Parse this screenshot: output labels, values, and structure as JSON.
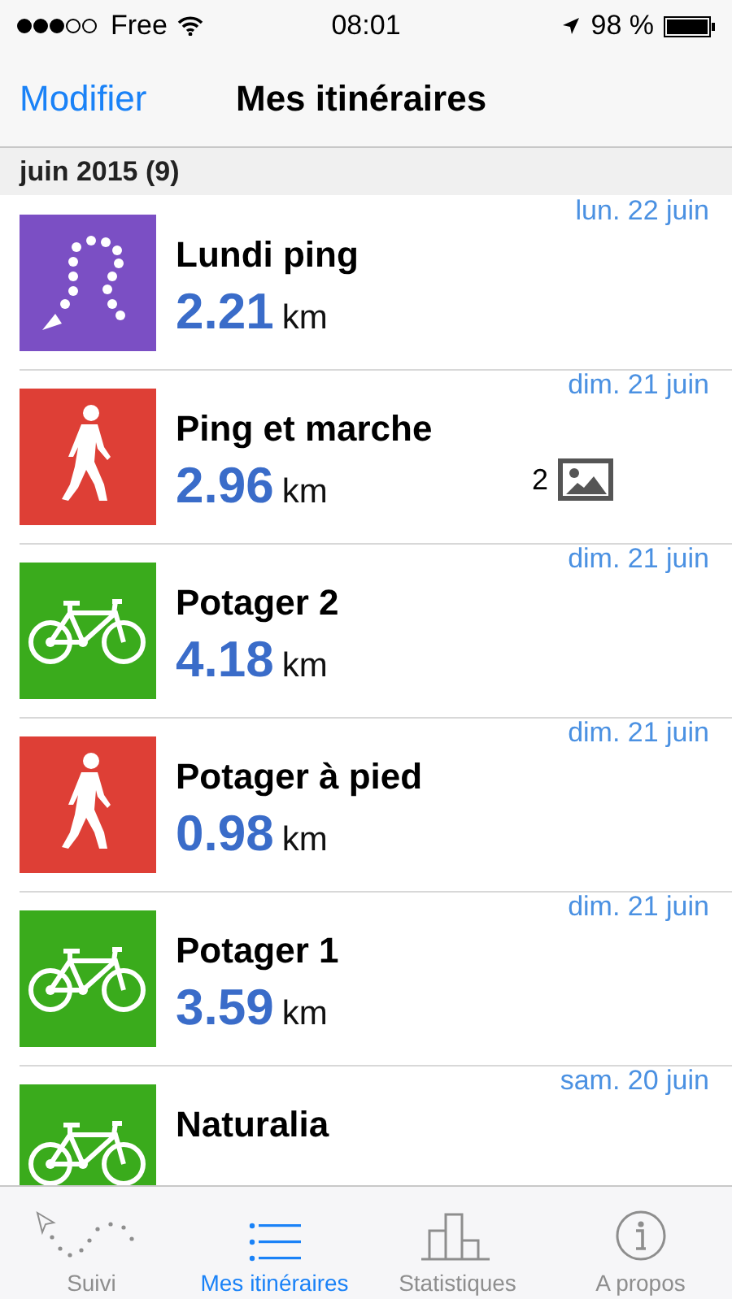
{
  "status_bar": {
    "carrier": "Free",
    "time": "08:01",
    "battery": "98 %"
  },
  "nav": {
    "edit": "Modifier",
    "title": "Mes itinéraires"
  },
  "section": {
    "title": "juin 2015 (9)"
  },
  "routes": [
    {
      "kind": "route",
      "color": "#7b4fc4",
      "name": "Lundi ping",
      "distance": "2.21",
      "unit": "km",
      "date": "lun. 22 juin"
    },
    {
      "kind": "walk",
      "color": "#de3f36",
      "name": "Ping et marche",
      "distance": "2.96",
      "unit": "km",
      "date": "dim. 21 juin",
      "photos": "2"
    },
    {
      "kind": "bike",
      "color": "#3aab1c",
      "name": "Potager 2",
      "distance": "4.18",
      "unit": "km",
      "date": "dim. 21 juin"
    },
    {
      "kind": "walk",
      "color": "#de3f36",
      "name": "Potager à pied",
      "distance": "0.98",
      "unit": "km",
      "date": "dim. 21 juin"
    },
    {
      "kind": "bike",
      "color": "#3aab1c",
      "name": "Potager 1",
      "distance": "3.59",
      "unit": "km",
      "date": "dim. 21 juin"
    },
    {
      "kind": "bike",
      "color": "#3aab1c",
      "name": "Naturalia",
      "date": "sam. 20 juin"
    }
  ],
  "tabs": [
    {
      "kind": "track",
      "label": "Suivi",
      "selected": false
    },
    {
      "kind": "list",
      "label": "Mes itinéraires",
      "selected": true
    },
    {
      "kind": "stats",
      "label": "Statistiques",
      "selected": false
    },
    {
      "kind": "info",
      "label": "A propos",
      "selected": false
    }
  ]
}
